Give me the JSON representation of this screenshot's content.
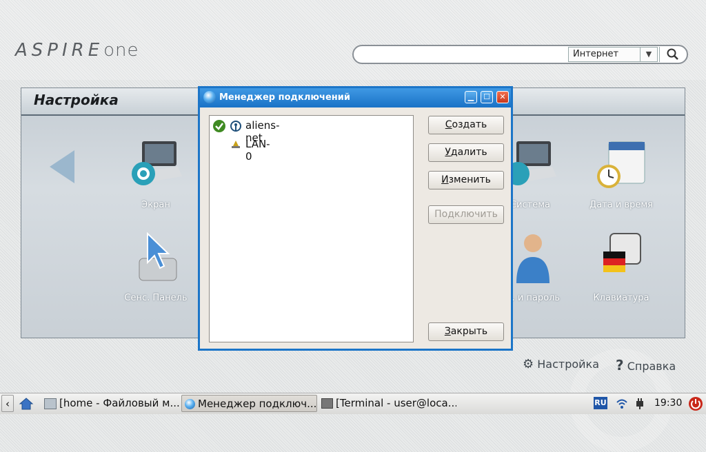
{
  "header": {
    "logo_main": "ASPIRE",
    "logo_suffix": "one",
    "search": {
      "placeholder": "",
      "select_value": "Интернет"
    }
  },
  "panel": {
    "title": "Настройка",
    "tiles": [
      {
        "label": "Экран"
      },
      {
        "label": "Система"
      },
      {
        "label": "Дата и время"
      },
      {
        "label": "Сенс. Панель"
      },
      {
        "label": "Из. и пароль"
      },
      {
        "label": "Клавиатура"
      }
    ]
  },
  "footer": {
    "settings": "Настройка",
    "help": "Справка"
  },
  "dialog": {
    "title": "Менеджер подключений",
    "connections": [
      "aliens-net",
      "LAN-0"
    ],
    "buttons": {
      "create_u": "С",
      "create_rest": "оздать",
      "delete_u": "У",
      "delete_rest": "далить",
      "edit_u": "И",
      "edit_rest": "зменить",
      "connect": "Подключить",
      "close_u": "З",
      "close_rest": "акрыть"
    }
  },
  "taskbar": {
    "items": [
      "[home - Файловый м...",
      "Менеджер подключ...",
      "[Terminal - user@loca..."
    ],
    "lang": "RU",
    "time": "19:30"
  }
}
